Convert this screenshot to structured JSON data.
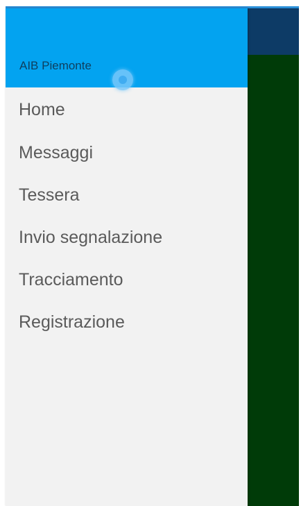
{
  "drawer": {
    "header_title": "AIB Piemonte",
    "items": [
      {
        "label": "Home"
      },
      {
        "label": "Messaggi"
      },
      {
        "label": "Tessera"
      },
      {
        "label": "Invio segnalazione"
      },
      {
        "label": "Tracciamento"
      },
      {
        "label": "Registrazione"
      }
    ]
  },
  "colors": {
    "header": "#03a3f0",
    "drawer_background": "#f2f2f2",
    "toolbar_behind": "#0d3b66",
    "content_behind": "#003b08",
    "menu_text": "#5a5a5a"
  }
}
